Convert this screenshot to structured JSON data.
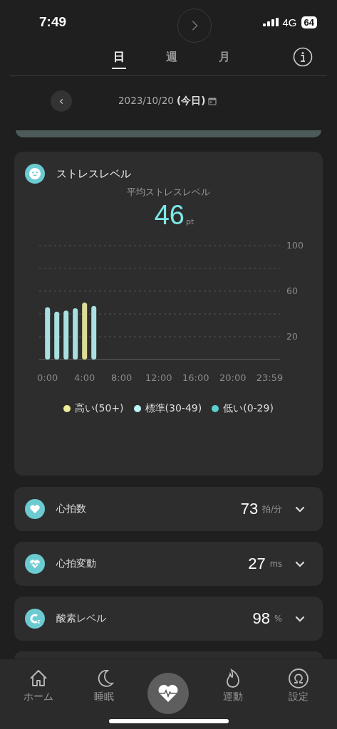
{
  "status_bar": {
    "time": "7:49",
    "network": "4G",
    "battery": "64"
  },
  "tabs": [
    {
      "label": "日",
      "selected": true
    },
    {
      "label": "週",
      "selected": false
    },
    {
      "label": "月",
      "selected": false
    }
  ],
  "date_nav": {
    "date": "2023/10/20 **(今日)**"
  },
  "stress_card": {
    "title": "ストレスレベル",
    "subtitle": "平均ストレスレベル",
    "value": "46",
    "unit": "pt",
    "chart_data": {
      "type": "bar",
      "x": [
        0,
        1,
        2,
        3,
        4,
        5
      ],
      "xlim": [
        -0.9,
        25.1
      ],
      "ylim": [
        0,
        100
      ],
      "yticks": [
        20,
        60,
        100
      ],
      "xticks": [
        {
          "value": 0,
          "label": "0:00"
        },
        {
          "value": 4,
          "label": "4:00"
        },
        {
          "value": 8,
          "label": "8:00"
        },
        {
          "value": 12,
          "label": "12:00"
        },
        {
          "value": 16,
          "label": "16:00"
        },
        {
          "value": 20,
          "label": "20:00"
        },
        {
          "value": 23.98,
          "label": "23:59"
        }
      ],
      "series": [
        {
          "values": [
            46,
            42,
            43,
            45,
            50,
            47
          ],
          "colors": [
            "#a8e0e2",
            "#a8e0e2",
            "#a8e0e2",
            "#a8e0e2",
            "#dcdc98",
            "#a8e0e2"
          ]
        }
      ]
    },
    "legend": [
      {
        "label": "高い(50+)",
        "color": "#eeee99"
      },
      {
        "label": "標準(30-49)",
        "color": "#bff5f7"
      },
      {
        "label": "低い(0-29)",
        "color": "#5ccfd0"
      }
    ]
  },
  "metrics": [
    {
      "kind": "heart",
      "label": "心拍数",
      "value": "73",
      "unit": "拍/分",
      "expanded": false
    },
    {
      "kind": "hrv",
      "label": "心拍変動",
      "value": "27",
      "unit": "ms",
      "expanded": false
    },
    {
      "kind": "oxygen",
      "label": "酸素レベル",
      "value": "98",
      "unit": "%",
      "expanded": false
    }
  ],
  "bottom_nav": [
    {
      "kind": "home",
      "label": "ホーム",
      "selected": false
    },
    {
      "kind": "sleep",
      "label": "睡眠",
      "selected": false
    },
    {
      "kind": "health",
      "selected": true
    },
    {
      "kind": "exercise",
      "label": "運動",
      "selected": false
    },
    {
      "kind": "settings",
      "label": "設定",
      "selected": false
    }
  ]
}
